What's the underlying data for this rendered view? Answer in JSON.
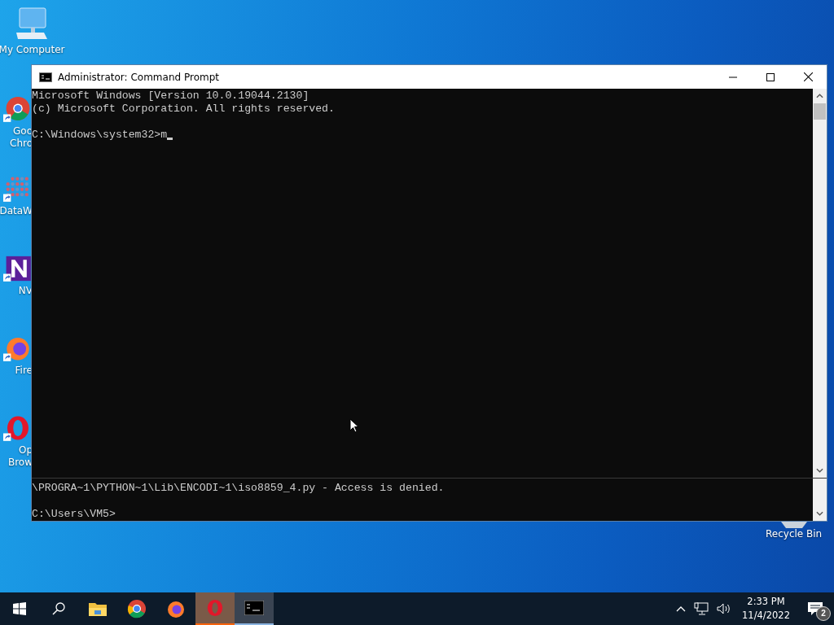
{
  "desktop_icons": [
    {
      "kind": "computer",
      "lines": [
        "My Computer"
      ]
    },
    {
      "kind": "chrome",
      "lines": [
        "Goo",
        "Chro"
      ]
    },
    {
      "kind": "datawrapper",
      "lines": [
        "DataW"
      ]
    },
    {
      "kind": "nv",
      "lines": [
        "NV"
      ]
    },
    {
      "kind": "firefox",
      "lines": [
        "Fire"
      ]
    },
    {
      "kind": "opera",
      "lines": [
        "Op",
        "Brow"
      ]
    }
  ],
  "recycle_bin": {
    "label": "Recycle Bin"
  },
  "window": {
    "title": "Administrator: Command Prompt",
    "console": {
      "blocks": [
        [
          "Microsoft Windows [Version 10.0.19044.2130]",
          "(c) Microsoft Corporation. All rights reserved."
        ],
        [
          "C:\\Windows\\system32>m"
        ]
      ],
      "cursor": true
    },
    "lower_pane": {
      "blocks": [
        [
          "\\PROGRA~1\\PYTHON~1\\Lib\\ENCODI~1\\iso8859_4.py - Access is denied."
        ],
        [
          "C:\\Users\\VM5>"
        ]
      ]
    }
  },
  "taskbar": {
    "items": [
      {
        "kind": "start",
        "selected": false,
        "flashing": false
      },
      {
        "kind": "search",
        "selected": false,
        "flashing": false
      },
      {
        "kind": "explorer",
        "selected": false,
        "flashing": false
      },
      {
        "kind": "chrome",
        "selected": false,
        "flashing": false
      },
      {
        "kind": "firefox",
        "selected": false,
        "flashing": false
      },
      {
        "kind": "opera",
        "selected": false,
        "flashing": true
      },
      {
        "kind": "cmd",
        "selected": true,
        "flashing": false
      }
    ],
    "time": "2:33 PM",
    "date": "11/4/2022",
    "notifications": "2"
  }
}
